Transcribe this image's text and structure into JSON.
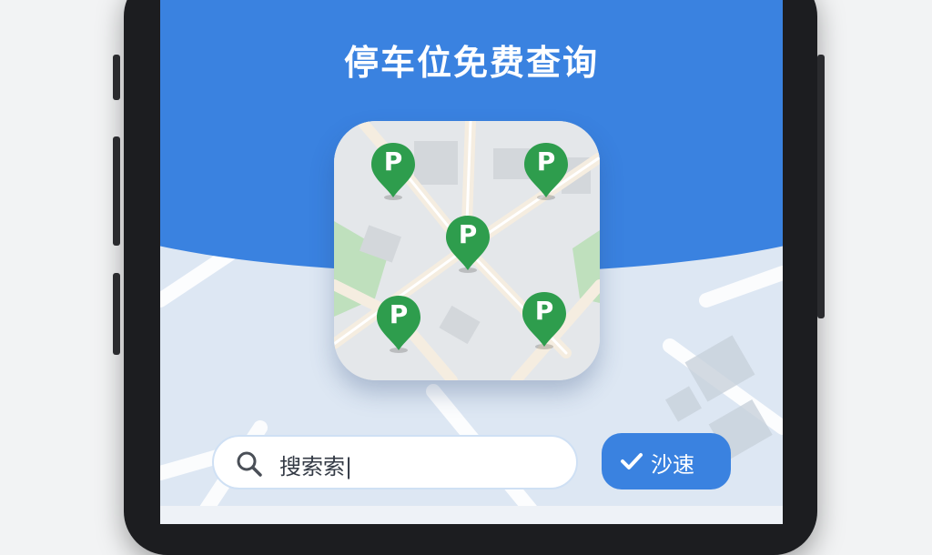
{
  "app": {
    "title": "停车位免费查询"
  },
  "icon": {
    "pin_label": "P",
    "pins": [
      "parking-pin-top-left",
      "parking-pin-top-right",
      "parking-pin-center",
      "parking-pin-bottom-left",
      "parking-pin-bottom-right"
    ]
  },
  "search": {
    "value": "搜索索|",
    "icon": "search-icon"
  },
  "quick_button": {
    "label": "沙速",
    "icon": "check-icon"
  },
  "colors": {
    "primary_blue": "#3a82e0",
    "pin_green": "#2e9d4d",
    "map_park_green": "#bfe0bd",
    "road": "#f5ede0"
  }
}
